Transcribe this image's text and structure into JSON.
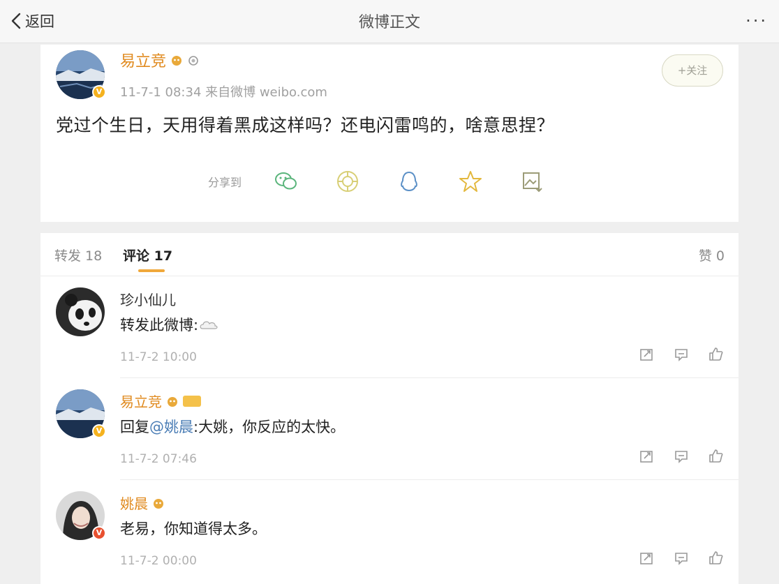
{
  "nav": {
    "back_label": "返回",
    "title": "微博正文",
    "more_label": "···"
  },
  "post": {
    "author": "易立竞",
    "meta": "11-7-1 08:34  来自微博 weibo.com",
    "follow_label": "+关注",
    "text": "党过个生日，天用得着黑成这样吗？还电闪雷鸣的，啥意思捏？",
    "share_label": "分享到",
    "share_icons": [
      "wechat-icon",
      "moments-icon",
      "qq-icon",
      "qzone-icon",
      "save-icon"
    ]
  },
  "tabs": {
    "repost": "转发 18",
    "comment": "评论 17",
    "likes": "赞 0"
  },
  "comments": [
    {
      "name": "珍小仙儿",
      "text": "转发此微博:",
      "time": "11-7-2 10:00"
    },
    {
      "name": "易立竞",
      "reply_prefix": "回复 ",
      "mention": "@姚晨",
      "text": ":大姚，你反应的太快。",
      "time": "11-7-2 07:46"
    },
    {
      "name": "姚晨",
      "text": "老易，你知道得太多。",
      "time": "11-7-2 00:00"
    }
  ],
  "colors": {
    "accent": "#e08a1e",
    "mention": "#4a7db5",
    "tab_underline": "#f0a83a"
  }
}
